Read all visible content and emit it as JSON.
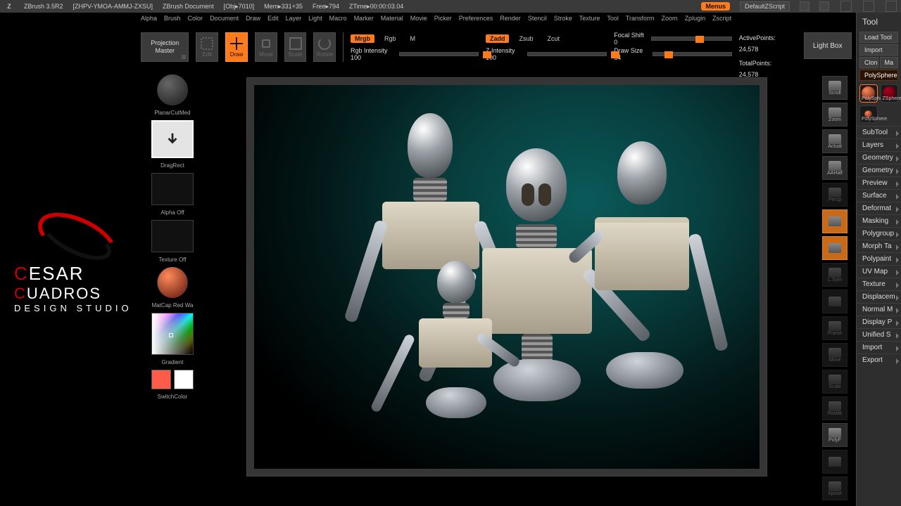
{
  "titlebar": {
    "app": "ZBrush 3.5R2",
    "doc_id": "[ZHPV-YMOA-AMMJ-ZXSU]",
    "doc": "ZBrush Document",
    "obj": "[Obj▸7010]",
    "mem": "Mem▸331+35",
    "free": "Free▸794",
    "ztime": "ZTime▸00:00:03.04",
    "menus_btn": "Menus",
    "default_script": "DefaultZScript"
  },
  "menu": [
    "Alpha",
    "Brush",
    "Color",
    "Document",
    "Draw",
    "Edit",
    "Layer",
    "Light",
    "Macro",
    "Marker",
    "Material",
    "Movie",
    "Picker",
    "Preferences",
    "Render",
    "Stencil",
    "Stroke",
    "Texture",
    "Tool",
    "Transform",
    "Zoom",
    "Zplugin",
    "Zscript"
  ],
  "proj_master": "Projection Master",
  "modes": {
    "edit": "Edit",
    "draw": "Draw",
    "move": "Move",
    "scale": "Scale",
    "rotate": "Rotate"
  },
  "opts": {
    "mrgb": "Mrgb",
    "rgb": "Rgb",
    "m": "M",
    "rgb_intensity": "Rgb Intensity 100",
    "zadd": "Zadd",
    "zsub": "Zsub",
    "zcut": "Zcut",
    "z_intensity": "Z Intensity 100",
    "focal_shift": "Focal Shift 0",
    "draw_size": "Draw Size 64"
  },
  "stats": {
    "active": "ActivePoints: 24,578",
    "total": "TotalPoints: 24,578"
  },
  "lightbox": "Light Box",
  "left": {
    "planar": "PlanarCutMed",
    "stroke": "DragRect",
    "alpha": "Alpha Off",
    "texture": "Texture Off",
    "material": "MatCap Red Wa",
    "gradient": "Gradient",
    "switch": "SwitchColor"
  },
  "ricons": [
    "Scroll",
    "Zoom",
    "Actual",
    "AAHalf",
    "Persp",
    "",
    "",
    "L.Sym",
    "",
    "Frame",
    "Move",
    "Scale",
    "Rotate",
    "PolyF",
    "",
    "Xpose"
  ],
  "ricons_meta": {
    "orange": [
      5,
      6
    ],
    "dim": [
      4,
      7,
      8,
      9,
      10,
      11,
      12,
      14,
      15
    ]
  },
  "tool": {
    "title": "Tool",
    "load": "Load Tool",
    "import": "Import",
    "clone": "Clone",
    "make": "Ma",
    "main": "PolySphere",
    "items": [
      "PolySphere",
      "ZSphere",
      "PolySphere"
    ],
    "sections": [
      "SubTool",
      "Layers",
      "Geometry",
      "Geometry",
      "Preview",
      "Surface",
      "Deformat",
      "Masking",
      "Polygroup",
      "Morph Ta",
      "Polypaint",
      "UV Map",
      "Texture",
      "Displacem",
      "Normal M",
      "Display P",
      "Unified S",
      "Import",
      "Export"
    ]
  },
  "logo": {
    "l1a": "C",
    "l1b": "ESAR",
    "l2a": "C",
    "l2b": "UADROS",
    "l3": "DESIGN STUDIO"
  }
}
